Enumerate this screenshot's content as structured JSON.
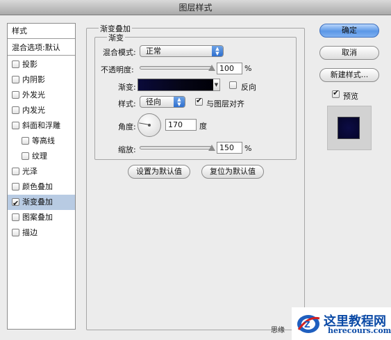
{
  "window": {
    "title": "图层样式"
  },
  "sidebar": {
    "header": "样式",
    "blend_options": "混合选项:默认",
    "items": [
      {
        "label": "投影",
        "checked": false,
        "indent": false
      },
      {
        "label": "内阴影",
        "checked": false,
        "indent": false
      },
      {
        "label": "外发光",
        "checked": false,
        "indent": false
      },
      {
        "label": "内发光",
        "checked": false,
        "indent": false
      },
      {
        "label": "斜面和浮雕",
        "checked": false,
        "indent": false
      },
      {
        "label": "等高线",
        "checked": false,
        "indent": true
      },
      {
        "label": "纹理",
        "checked": false,
        "indent": true
      },
      {
        "label": "光泽",
        "checked": false,
        "indent": false
      },
      {
        "label": "颜色叠加",
        "checked": false,
        "indent": false
      },
      {
        "label": "渐变叠加",
        "checked": true,
        "indent": false,
        "selected": true
      },
      {
        "label": "图案叠加",
        "checked": false,
        "indent": false
      },
      {
        "label": "描边",
        "checked": false,
        "indent": false
      }
    ]
  },
  "panel": {
    "outer_title": "渐变叠加",
    "inner_title": "渐变",
    "blend_mode_label": "混合模式:",
    "blend_mode_value": "正常",
    "opacity_label": "不透明度:",
    "opacity_value": "100",
    "percent": "%",
    "gradient_label": "渐变:",
    "reverse_label": "反向",
    "style_label": "样式:",
    "style_value": "径向",
    "align_label": "与图层对齐",
    "angle_label": "角度:",
    "angle_value": "170",
    "degree_unit": "度",
    "scale_label": "缩放:",
    "scale_value": "150",
    "scale_percent": "%",
    "set_default_button": "设置为默认值",
    "reset_default_button": "复位为默认值",
    "opacity_fraction": 1.0,
    "scale_fraction": 1.0,
    "align_checked": true,
    "reverse_checked": false
  },
  "actions": {
    "ok": "确定",
    "cancel": "取消",
    "new_style": "新建样式...",
    "preview_label": "预览",
    "preview_checked": true
  },
  "watermark": {
    "title": "这里教程网",
    "url": "herecours.com",
    "overlap_text": "思缘"
  },
  "colors": {
    "gradient_start": "#0a0a3a",
    "gradient_end": "#000008",
    "selection": "#b8cbe3",
    "primary_button": "#5b97e6",
    "watermark_blue": "#0b4aa6"
  }
}
